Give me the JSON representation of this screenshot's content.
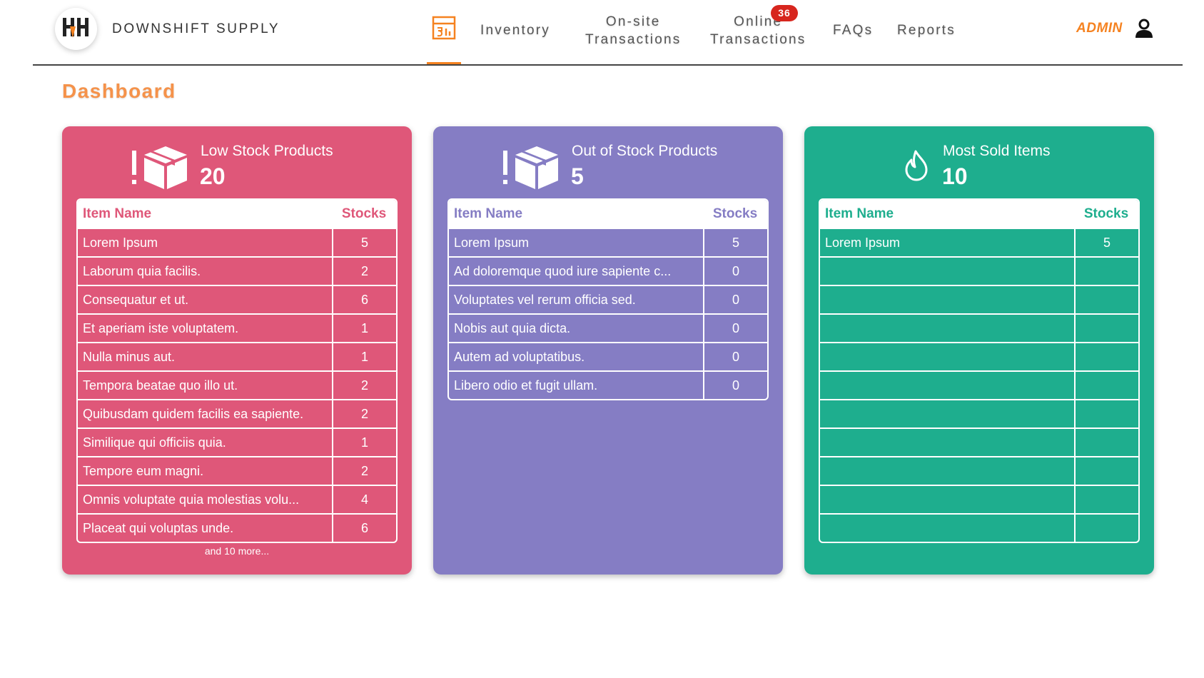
{
  "header": {
    "brand": "DOWNSHIFT SUPPLY",
    "nav": [
      {
        "label": "Inventory"
      },
      {
        "label_line1": "On-site",
        "label_line2": "Transactions"
      },
      {
        "label_line1": "Online",
        "label_line2": "Transactions",
        "badge": "36"
      },
      {
        "label": "FAQs"
      },
      {
        "label": "Reports"
      }
    ],
    "user": "ADMIN",
    "active_icon": "dashboard-icon"
  },
  "page": {
    "title": "Dashboard"
  },
  "colors": {
    "accent": "#f58220",
    "low_stock": "#df5779",
    "out_of_stock": "#857dc4",
    "most_sold": "#1eae8e",
    "badge": "#d7261e"
  },
  "cards": {
    "low_stock": {
      "title": "Low Stock Products",
      "count": "20",
      "icon": "box-alert-icon",
      "columns": [
        "Item Name",
        "Stocks"
      ],
      "rows": [
        [
          "Lorem Ipsum",
          "5"
        ],
        [
          "Laborum quia facilis.",
          "2"
        ],
        [
          "Consequatur et ut.",
          "6"
        ],
        [
          "Et aperiam iste voluptatem.",
          "1"
        ],
        [
          "Nulla minus aut.",
          "1"
        ],
        [
          "Tempora beatae quo illo ut.",
          "2"
        ],
        [
          "Quibusdam quidem facilis ea sapiente.",
          "2"
        ],
        [
          "Similique qui officiis quia.",
          "1"
        ],
        [
          "Tempore eum magni.",
          "2"
        ],
        [
          "Omnis voluptate quia molestias volu...",
          "4"
        ],
        [
          "Placeat qui voluptas unde.",
          "6"
        ]
      ],
      "more": "and 10 more..."
    },
    "out_of_stock": {
      "title": "Out of Stock Products",
      "count": "5",
      "icon": "box-alert-icon",
      "columns": [
        "Item Name",
        "Stocks"
      ],
      "rows": [
        [
          "Lorem Ipsum",
          "5"
        ],
        [
          "Ad doloremque quod iure sapiente c...",
          "0"
        ],
        [
          "Voluptates vel rerum officia sed.",
          "0"
        ],
        [
          "Nobis aut quia dicta.",
          "0"
        ],
        [
          "Autem ad voluptatibus.",
          "0"
        ],
        [
          "Libero odio et fugit ullam.",
          "0"
        ]
      ]
    },
    "most_sold": {
      "title": "Most Sold Items",
      "count": "10",
      "icon": "flame-icon",
      "columns": [
        "Item Name",
        "Stocks"
      ],
      "rows": [
        [
          "Lorem Ipsum",
          "5"
        ],
        [
          "",
          ""
        ],
        [
          "",
          ""
        ],
        [
          "",
          ""
        ],
        [
          "",
          ""
        ],
        [
          "",
          ""
        ],
        [
          "",
          ""
        ],
        [
          "",
          ""
        ],
        [
          "",
          ""
        ],
        [
          "",
          ""
        ],
        [
          "",
          ""
        ]
      ]
    }
  }
}
